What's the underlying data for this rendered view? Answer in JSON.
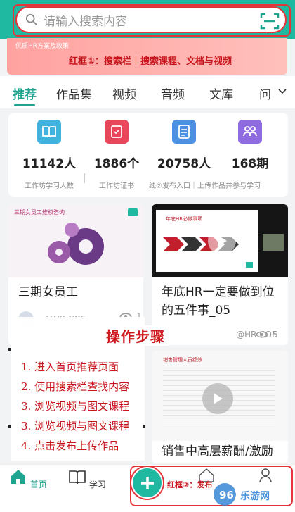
{
  "search": {
    "placeholder": "请输入搜索内容"
  },
  "banner": {
    "subtitle": "优质HR方案及政策",
    "annotation": "红框①：搜索栏｜搜索课程、文档与视频"
  },
  "tabs": [
    "推荐",
    "作品集",
    "视频",
    "音频",
    "文库",
    "问"
  ],
  "stats": [
    {
      "value": "11142人",
      "label": "工作坊学习人数",
      "icon": "book-icon",
      "color": "#3fb3dd"
    },
    {
      "value": "1886个",
      "label": "工作坊证书",
      "icon": "certificate-icon",
      "color": "#e8465a"
    },
    {
      "value": "20758人",
      "label": "线②发布入口｜上传作品并参与学习",
      "icon": "document-icon",
      "color": "#4d8fe0"
    },
    {
      "value": "168期",
      "label": "",
      "icon": "people-icon",
      "color": "#8e6be0"
    }
  ],
  "cards": [
    {
      "title": "三期女员工",
      "author": "@HR COE",
      "views": "1",
      "thumb_text": "三期女员工维权咨询"
    },
    {
      "title": "年底HR一定要做到位的五件事_05",
      "author": "@HR COE",
      "views": "5",
      "thumb_text": "年底HR必做事项"
    },
    {
      "title": "销售中高层薪酬/激励",
      "thumb_text": "销售管理人员绩效"
    }
  ],
  "steps": {
    "title": "操作步骤",
    "items": [
      "1. 进入首页推荐页面",
      "2. 使用搜索栏查找内容",
      "3. 浏览视频与图文课程",
      "3. 浏览视频与图文课程",
      "4. 点击发布上传作品"
    ]
  },
  "nav": {
    "home": "首页",
    "learn": "学习",
    "annotation": "红框②：发布",
    "watermark": "962乐游网"
  }
}
